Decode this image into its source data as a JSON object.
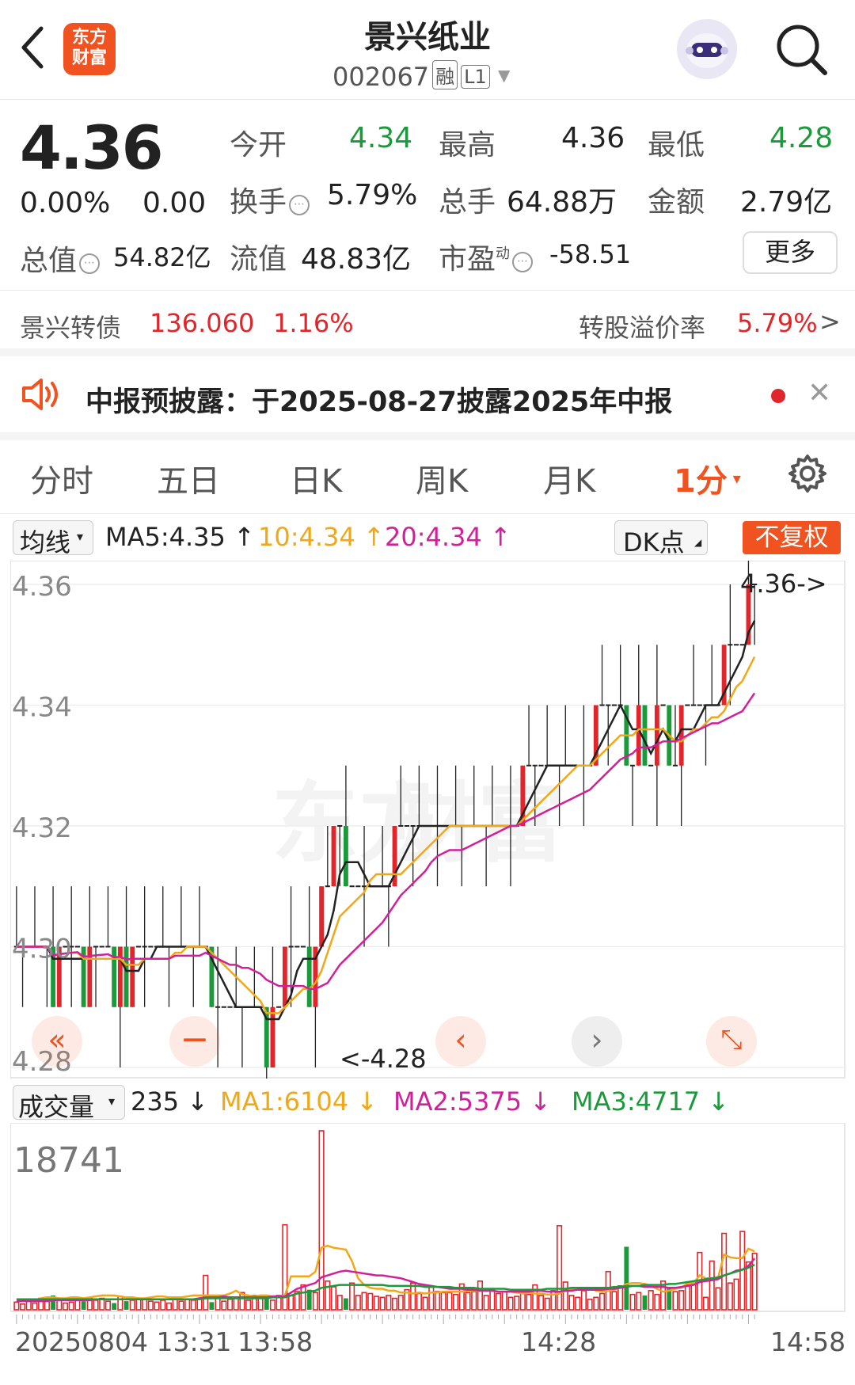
{
  "header": {
    "back_icon": "chevron-left-icon",
    "logo_line1": "东方",
    "logo_line2": "财富",
    "title": "景兴纸业",
    "code": "002067",
    "tag_margin": "融",
    "tag_level": "L1",
    "robot_icon": "robot-assistant-icon",
    "search_icon": "search-icon"
  },
  "quote": {
    "price": "4.36",
    "change_pct": "0.00%",
    "change": "0.00",
    "open_label": "今开",
    "open": "4.34",
    "high_label": "最高",
    "high": "4.36",
    "low_label": "最低",
    "low": "4.28",
    "turnover_label": "换手",
    "turnover": "5.79%",
    "volume_label": "总手",
    "volume": "64.88万",
    "amount_label": "金额",
    "amount": "2.79亿",
    "mktcap_label": "总值",
    "mktcap": "54.82亿",
    "float_label": "流值",
    "float": "48.83亿",
    "pe_label": "市盈",
    "pe_sup": "动",
    "pe": "-58.51",
    "more_label": "更多"
  },
  "bond": {
    "name": "景兴转债",
    "price": "136.060",
    "pct": "1.16%",
    "premium_label": "转股溢价率",
    "premium": "5.79%",
    "arrow": ">"
  },
  "notice": {
    "icon": "speaker-icon",
    "text": "中报预披露：于2025-08-27披露2025年中报",
    "close": "✕"
  },
  "tabs": [
    "分时",
    "五日",
    "日K",
    "周K",
    "月K",
    "1分"
  ],
  "tabs_active": "1分",
  "settings_icon": "gear-icon",
  "ma_row": {
    "dropdown": "均线",
    "ma5": "MA5:4.35",
    "ma10": "10:4.34",
    "ma20": "20:4.34",
    "arrow": "↑",
    "dk": "DK点",
    "fq": "不复权"
  },
  "vol_row": {
    "dropdown": "成交量",
    "current": "235",
    "ma1": "MA1:6104",
    "ma2": "MA2:5375",
    "ma3": "MA3:4717",
    "arrow": "↓"
  },
  "colors": {
    "up": "#e0262b",
    "down": "#1a9a3a",
    "ma5": "#222222",
    "ma10": "#f0a818",
    "ma20": "#d0209a",
    "accent": "#f0531f"
  },
  "chart_data": {
    "type": "candlestick",
    "price_axis": [
      "4.36",
      "4.34",
      "4.32",
      "4.30",
      "4.28"
    ],
    "ylim": [
      4.28,
      4.36
    ],
    "max_label": "4.36->",
    "min_label": "<-4.28",
    "volume_axis_max": "18741",
    "x_labels": [
      "20250804 13:31",
      "13:58",
      "14:28",
      "14:58"
    ],
    "closes": [
      4.3,
      4.3,
      4.3,
      4.3,
      4.3,
      4.3,
      4.29,
      4.3,
      4.3,
      4.3,
      4.3,
      4.29,
      4.3,
      4.3,
      4.3,
      4.3,
      4.29,
      4.3,
      4.29,
      4.3,
      4.3,
      4.3,
      4.3,
      4.3,
      4.3,
      4.3,
      4.3,
      4.3,
      4.3,
      4.3,
      4.3,
      4.3,
      4.29,
      4.29,
      4.29,
      4.29,
      4.29,
      4.29,
      4.29,
      4.29,
      4.29,
      4.28,
      4.29,
      4.29,
      4.3,
      4.3,
      4.3,
      4.3,
      4.29,
      4.3,
      4.31,
      4.31,
      4.32,
      4.32,
      4.31,
      4.31,
      4.31,
      4.31,
      4.31,
      4.31,
      4.31,
      4.31,
      4.32,
      4.32,
      4.32,
      4.32,
      4.32,
      4.32,
      4.32,
      4.32,
      4.32,
      4.32,
      4.32,
      4.32,
      4.32,
      4.32,
      4.32,
      4.32,
      4.32,
      4.32,
      4.32,
      4.32,
      4.32,
      4.33,
      4.33,
      4.33,
      4.33,
      4.33,
      4.33,
      4.33,
      4.33,
      4.33,
      4.33,
      4.33,
      4.33,
      4.34,
      4.34,
      4.34,
      4.34,
      4.34,
      4.33,
      4.33,
      4.34,
      4.33,
      4.33,
      4.34,
      4.34,
      4.33,
      4.33,
      4.34,
      4.34,
      4.34,
      4.34,
      4.34,
      4.34,
      4.34,
      4.35,
      4.35,
      4.35,
      4.35,
      4.36,
      4.36
    ],
    "volumes": [
      800,
      600,
      900,
      700,
      1200,
      900,
      1500,
      1000,
      700,
      800,
      1100,
      900,
      1300,
      1000,
      1200,
      900,
      700,
      1400,
      900,
      1000,
      1100,
      1200,
      900,
      800,
      1000,
      700,
      1300,
      900,
      1100,
      1000,
      1200,
      3600,
      800,
      1500,
      900,
      1100,
      1300,
      1800,
      1000,
      1500,
      1200,
      1300,
      1000,
      1500,
      8900,
      1500,
      1900,
      2600,
      2100,
      1800,
      18741,
      3000,
      2400,
      1500,
      1200,
      2800,
      1500,
      1800,
      1700,
      1400,
      1300,
      1500,
      1200,
      1500,
      2100,
      2800,
      1700,
      1300,
      2400,
      1900,
      1800,
      1800,
      1600,
      2700,
      1800,
      1900,
      3000,
      1500,
      2100,
      1700,
      1900,
      1300,
      1400,
      2000,
      1600,
      2600,
      1500,
      1200,
      2000,
      8800,
      2900,
      1500,
      1300,
      2000,
      1100,
      1300,
      1700,
      4000,
      1900,
      2500,
      6600,
      1600,
      1800,
      1500,
      2000,
      1600,
      3000,
      2400,
      1900,
      2000,
      2600,
      2900,
      6000,
      1300,
      5100,
      2300,
      8000,
      2800,
      3200,
      8200,
      5000,
      5900
    ],
    "ma1_vol": [
      1000,
      1000,
      1000,
      1000,
      1200,
      1300,
      1300,
      1200,
      1200,
      1300,
      1300,
      1200,
      1300,
      1400,
      1500,
      1500,
      1500,
      1400,
      1300,
      1300,
      1200,
      1200,
      1300,
      1400,
      1400,
      1300,
      1300,
      1300,
      1400,
      1500,
      1500,
      1500,
      1500,
      1500,
      1500,
      1700,
      2000,
      1600,
      1500,
      1400,
      1500,
      1500,
      1400,
      1400,
      1500,
      3500,
      3500,
      3500,
      3500,
      4000,
      6500,
      6700,
      6500,
      6400,
      6300,
      5100,
      3300,
      2600,
      2300,
      2200,
      2200,
      2000,
      2000,
      1800,
      1800,
      1700,
      1800,
      1700,
      1800,
      1800,
      1900,
      1900,
      1900,
      1900,
      2000,
      2000,
      2000,
      2000,
      2000,
      1900,
      1900,
      1900,
      1800,
      1700,
      1800,
      1700,
      1700,
      1600,
      1600,
      1700,
      2000,
      2200,
      2300,
      2300,
      2300,
      2000,
      1900,
      2000,
      2100,
      2300,
      2700,
      2800,
      2800,
      2700,
      2500,
      2200,
      1900,
      2000,
      2200,
      2300,
      2800,
      2800,
      3600,
      3300,
      3300,
      3300,
      5800,
      5500,
      5400,
      5400,
      6400,
      6104
    ],
    "ma2_vol": [
      900,
      900,
      900,
      900,
      900,
      900,
      1000,
      1000,
      1000,
      1000,
      1000,
      1000,
      1000,
      1100,
      1100,
      1100,
      1100,
      1100,
      1100,
      1100,
      1100,
      1100,
      1100,
      1100,
      1100,
      1100,
      1100,
      1100,
      1100,
      1100,
      1200,
      1300,
      1300,
      1300,
      1400,
      1300,
      1300,
      1300,
      1300,
      1300,
      1300,
      1300,
      1400,
      1400,
      1400,
      1800,
      2200,
      2400,
      2600,
      2800,
      3400,
      3600,
      3800,
      4000,
      4100,
      4000,
      3900,
      3800,
      3700,
      3600,
      3600,
      3500,
      3400,
      3300,
      3100,
      2900,
      2700,
      2600,
      2500,
      2400,
      2300,
      2200,
      2200,
      2200,
      2100,
      2100,
      2000,
      2000,
      2000,
      1900,
      1900,
      1900,
      1900,
      1900,
      1900,
      2000,
      2000,
      1900,
      1900,
      1900,
      2000,
      2000,
      2100,
      2100,
      2100,
      2100,
      2100,
      2200,
      2200,
      2300,
      2400,
      2500,
      2500,
      2400,
      2400,
      2400,
      2400,
      2300,
      2300,
      2400,
      2500,
      2600,
      2900,
      3000,
      3100,
      3200,
      3600,
      3800,
      4100,
      4200,
      4600,
      5375
    ],
    "ma3_vol": [
      1100,
      1100,
      1100,
      1100,
      1100,
      1100,
      1100,
      1100,
      1100,
      1100,
      1100,
      1100,
      1100,
      1100,
      1100,
      1100,
      1100,
      1100,
      1100,
      1100,
      1100,
      1100,
      1100,
      1100,
      1100,
      1100,
      1100,
      1100,
      1100,
      1100,
      1100,
      1200,
      1200,
      1200,
      1200,
      1200,
      1200,
      1200,
      1200,
      1200,
      1200,
      1200,
      1300,
      1300,
      1300,
      1500,
      1700,
      1800,
      1900,
      2000,
      2300,
      2400,
      2500,
      2600,
      2600,
      2600,
      2600,
      2600,
      2600,
      2600,
      2600,
      2500,
      2500,
      2500,
      2500,
      2500,
      2500,
      2400,
      2400,
      2400,
      2400,
      2400,
      2300,
      2300,
      2300,
      2300,
      2200,
      2200,
      2200,
      2200,
      2200,
      2100,
      2100,
      2100,
      2100,
      2100,
      2100,
      2200,
      2200,
      2200,
      2200,
      2300,
      2300,
      2300,
      2300,
      2300,
      2300,
      2300,
      2400,
      2400,
      2500,
      2500,
      2500,
      2600,
      2600,
      2600,
      2600,
      2700,
      2700,
      2800,
      2900,
      3000,
      3100,
      3200,
      3300,
      3400,
      3600,
      3800,
      4000,
      4200,
      4400,
      4717
    ]
  }
}
